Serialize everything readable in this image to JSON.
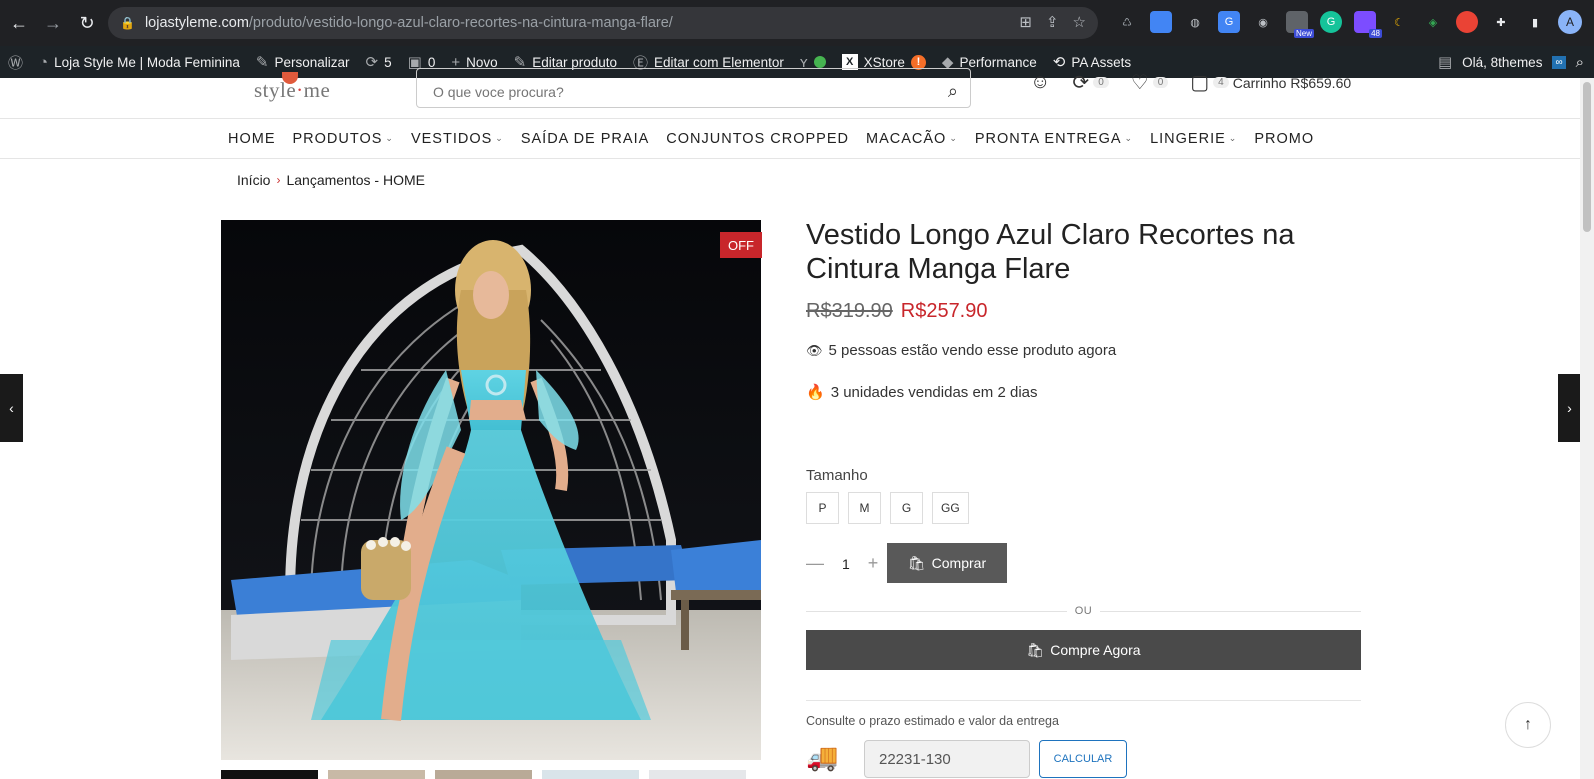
{
  "browser": {
    "url_host": "lojastyleme.com",
    "url_path": "/produto/vestido-longo-azul-claro-recortes-na-cintura-manga-flare/",
    "avatar_letter": "A",
    "ext_badge_new": "New",
    "ext_badge_count": "48"
  },
  "adminbar": {
    "site_name": "Loja Style Me | Moda Feminina",
    "customize": "Personalizar",
    "updates_count": "5",
    "comments_count": "0",
    "new": "Novo",
    "edit_product": "Editar produto",
    "edit_elementor": "Editar com Elementor",
    "xstore": "XStore",
    "xstore_badge": "!",
    "performance": "Performance",
    "pa_assets": "PA Assets",
    "greeting": "Olá, 8themes"
  },
  "header": {
    "logo_text_a": "style",
    "logo_dot": "·",
    "logo_text_b": "me",
    "search_placeholder": "O que voce procura?",
    "compare_count": "0",
    "wishlist_count": "0",
    "cart_count": "4",
    "cart_label": "Carrinho",
    "cart_total": "R$659.60"
  },
  "menu": [
    {
      "label": "HOME",
      "chevron": false
    },
    {
      "label": "PRODUTOS",
      "chevron": true
    },
    {
      "label": "VESTIDOS",
      "chevron": true
    },
    {
      "label": "SAÍDA DE PRAIA",
      "chevron": false
    },
    {
      "label": "CONJUNTOS CROPPED",
      "chevron": false
    },
    {
      "label": "MACACÃO",
      "chevron": true
    },
    {
      "label": "PRONTA ENTREGA",
      "chevron": true
    },
    {
      "label": "LINGERIE",
      "chevron": true
    },
    {
      "label": "PROMO",
      "chevron": false
    }
  ],
  "breadcrumb": {
    "home": "Início",
    "current": "Lançamentos - HOME"
  },
  "product": {
    "badge": "OFF",
    "title": "Vestido Longo Azul Claro Recortes na Cintura Manga Flare",
    "old_price": "R$319.90",
    "new_price": "R$257.90",
    "viewers": "5 pessoas estão vendo esse produto agora",
    "sold": "3 unidades vendidas em 2 dias",
    "size_label": "Tamanho",
    "sizes": [
      "P",
      "M",
      "G",
      "GG"
    ],
    "quantity": "1",
    "buy_label": "Comprar",
    "or_label": "OU",
    "buy_now_label": "Compre Agora"
  },
  "shipping": {
    "label": "Consulte o prazo estimado e valor da entrega",
    "cep_value": "22231-130",
    "calc_label": "CALCULAR"
  },
  "colors": {
    "accent_red": "#c8262b",
    "button_gray": "#595959",
    "dress_blue": "#5fd3e3",
    "link_blue": "#1e73be"
  }
}
